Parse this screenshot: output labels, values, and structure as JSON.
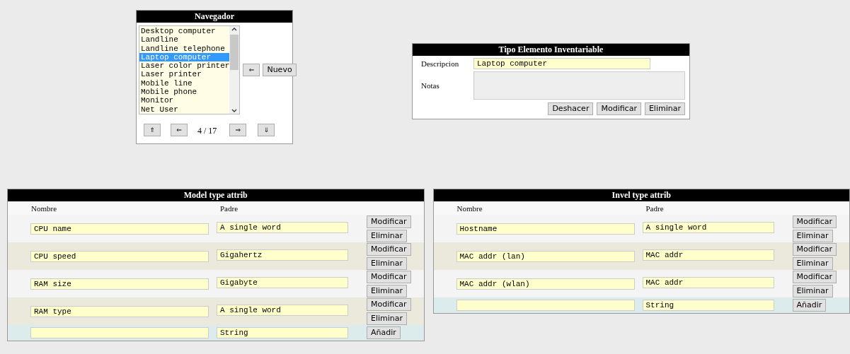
{
  "navigator": {
    "title": "Navegador",
    "items": [
      {
        "label": "Desktop computer",
        "selected": false
      },
      {
        "label": "Landline",
        "selected": false
      },
      {
        "label": "Landline telephone",
        "selected": false
      },
      {
        "label": "Laptop computer",
        "selected": true
      },
      {
        "label": "Laser color printer",
        "selected": false
      },
      {
        "label": "Laser printer",
        "selected": false
      },
      {
        "label": "Mobile line",
        "selected": false
      },
      {
        "label": "Mobile phone",
        "selected": false
      },
      {
        "label": "Monitor",
        "selected": false
      },
      {
        "label": "Net User",
        "selected": false
      }
    ],
    "side_buttons": [
      "⇐",
      "Nuevo"
    ],
    "nav_buttons": [
      "⇑",
      "⇐",
      "⇒",
      "⇓"
    ],
    "page": "4 / 17"
  },
  "detail": {
    "title": "Tipo Elemento Inventariable",
    "fields": [
      {
        "label": "Descripcion",
        "kind": "input",
        "value": "Laptop computer"
      },
      {
        "label": "Notas",
        "kind": "textarea"
      }
    ],
    "buttons": [
      "Deshacer",
      "Modificar",
      "Eliminar"
    ]
  },
  "tables": [
    {
      "title": "Model type attrib",
      "columns": [
        "Nombre",
        "Padre"
      ],
      "rows": [
        {
          "nombre": "CPU name",
          "padre": "A single word",
          "buttons": [
            "Modificar",
            "Eliminar"
          ]
        },
        {
          "nombre": "CPU speed",
          "padre": "Gigahertz",
          "buttons": [
            "Modificar",
            "Eliminar"
          ]
        },
        {
          "nombre": "RAM size",
          "padre": "Gigabyte",
          "buttons": [
            "Modificar",
            "Eliminar"
          ]
        },
        {
          "nombre": "RAM type",
          "padre": "A single word",
          "buttons": [
            "Modificar",
            "Eliminar"
          ]
        }
      ],
      "new_row": {
        "padre": "String",
        "button": "Añadir"
      }
    },
    {
      "title": "Invel type attrib",
      "columns": [
        "Nombre",
        "Padre"
      ],
      "rows": [
        {
          "nombre": "Hostname",
          "padre": "A single word",
          "buttons": [
            "Modificar",
            "Eliminar"
          ]
        },
        {
          "nombre": "MAC addr (lan)",
          "padre": "MAC addr",
          "buttons": [
            "Modificar",
            "Eliminar"
          ]
        },
        {
          "nombre": "MAC addr (wlan)",
          "padre": "MAC addr",
          "buttons": [
            "Modificar",
            "Eliminar"
          ]
        }
      ],
      "new_row": {
        "padre": "String",
        "button": "Añadir"
      }
    }
  ]
}
